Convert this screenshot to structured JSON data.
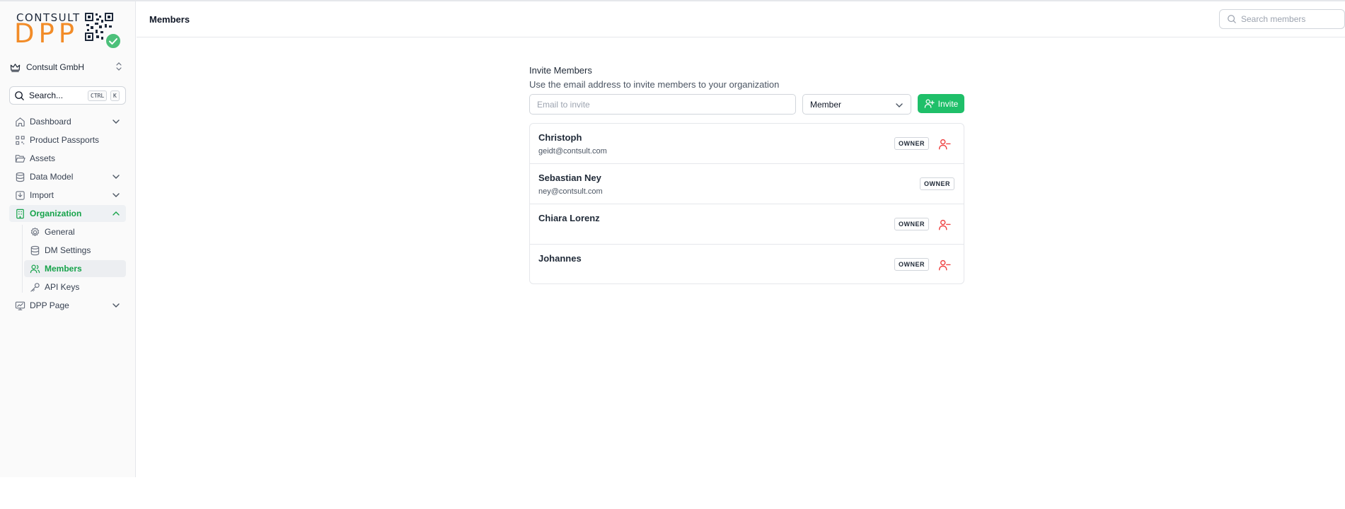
{
  "brand": {
    "line1": "CONTSULT",
    "line2": "DPP"
  },
  "org": {
    "name": "Contsult GmbH"
  },
  "sidebar_search": {
    "label": "Search...",
    "kbd1": "CTRL",
    "kbd2": "K"
  },
  "nav": {
    "dashboard": "Dashboard",
    "passports": "Product Passports",
    "assets": "Assets",
    "data_model": "Data Model",
    "import": "Import",
    "organization": "Organization",
    "general": "General",
    "dm_settings": "DM Settings",
    "members": "Members",
    "api_keys": "API Keys",
    "dpp_page": "DPP Page"
  },
  "header": {
    "title": "Members",
    "search_placeholder": "Search members"
  },
  "invite": {
    "heading": "Invite Members",
    "description": "Use the email address to invite members to your organization",
    "email_placeholder": "Email to invite",
    "role": "Member",
    "button": "Invite"
  },
  "members": [
    {
      "name": "Christoph",
      "email": "geidt@contsult.com",
      "role": "OWNER"
    },
    {
      "name": "Sebastian Ney",
      "email": "ney@contsult.com",
      "role": "OWNER"
    },
    {
      "name": "Chiara Lorenz",
      "email": "",
      "role": "OWNER"
    },
    {
      "name": "Johannes",
      "email": "",
      "role": "OWNER"
    }
  ],
  "colors": {
    "accent": "#16a34a",
    "button": "#1fbf69",
    "logo_orange": "#f28c28",
    "danger": "#ef4444"
  }
}
